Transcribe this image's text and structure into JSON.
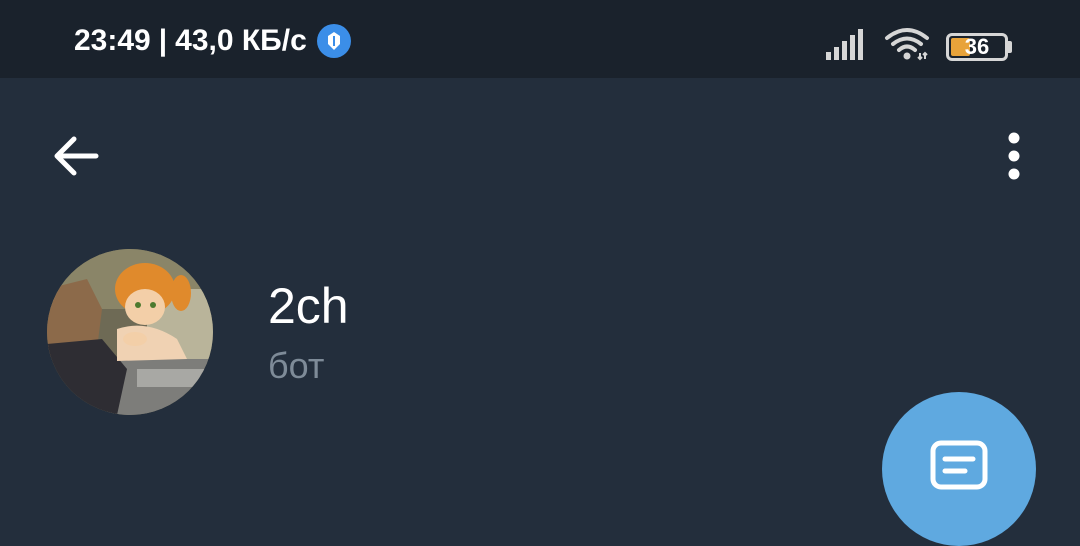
{
  "status_bar": {
    "time": "23:49",
    "separator": "|",
    "network_speed": "43,0 КБ/с",
    "battery_level": "36",
    "battery_fraction": 0.36,
    "icons": [
      "network-speed-icon",
      "signal-icon",
      "wifi-icon",
      "battery-icon"
    ]
  },
  "toolbar": {
    "back_icon": "arrow-left-icon",
    "menu_icon": "more-vertical-icon"
  },
  "chat": {
    "name": "2ch",
    "subtitle": "бот"
  },
  "fab": {
    "icon": "message-icon"
  },
  "colors": {
    "background": "#232e3c",
    "status_bar": "#1a222c",
    "accent": "#5fa9e0",
    "subtitle": "#7e8b98"
  }
}
